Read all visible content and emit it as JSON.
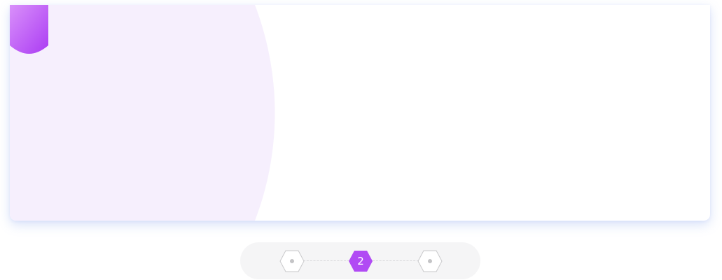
{
  "colors": {
    "accent": "#b14bf4",
    "accent_light": "#d990fa",
    "card_tint": "#f6effd",
    "stepper_bg": "#f5f5f6",
    "inactive_step_border": "#c9c9cb"
  },
  "card": {
    "bookmark_icon": "bookmark-ribbon"
  },
  "stepper": {
    "steps": [
      {
        "label": "",
        "state": "inactive"
      },
      {
        "label": "2",
        "state": "active"
      },
      {
        "label": "",
        "state": "inactive"
      }
    ]
  }
}
